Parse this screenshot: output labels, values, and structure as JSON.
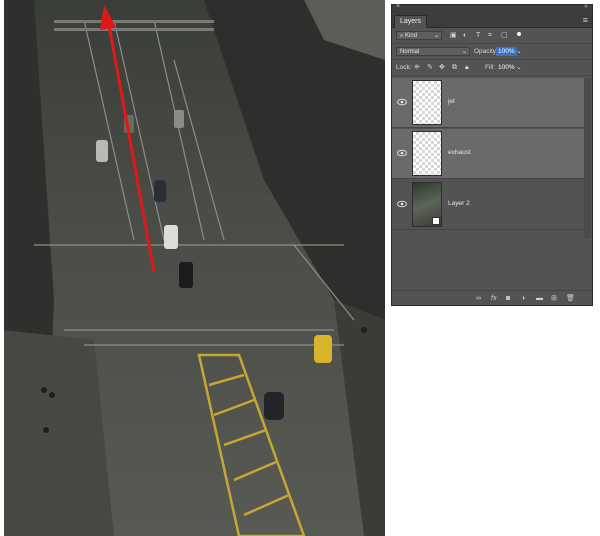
{
  "panel": {
    "title": "Layers",
    "close_glyph": "×",
    "collapse_glyph": "«",
    "menu_glyph": "≡",
    "filter": {
      "kind_label": "Kind",
      "icons": [
        "search-icon",
        "image-filter-icon",
        "adjustment-filter-icon",
        "type-filter-icon",
        "shape-filter-icon",
        "smart-object-filter-icon",
        "filter-toggle-icon"
      ]
    },
    "blend_mode": "Normal",
    "opacity_label": "Opacity:",
    "opacity_value": "100%",
    "lock_label": "Lock:",
    "fill_label": "Fill:",
    "fill_value": "100%",
    "layers": [
      {
        "name": "jet",
        "visible": true,
        "thumb": "transparent",
        "highlighted": true
      },
      {
        "name": "exhaust",
        "visible": true,
        "thumb": "transparent",
        "highlighted": true
      },
      {
        "name": "Layer 2",
        "visible": true,
        "thumb": "photo",
        "highlighted": false
      }
    ],
    "footer_icons": [
      "link-icon",
      "fx-icon",
      "mask-icon",
      "adjustment-icon",
      "folder-icon",
      "new-layer-icon",
      "trash-icon"
    ]
  },
  "colors": {
    "panel_bg": "#535353",
    "selection_blue": "#3c6fbf",
    "arrow_red": "#e01818",
    "taxi_yellow": "#d9b42a"
  }
}
